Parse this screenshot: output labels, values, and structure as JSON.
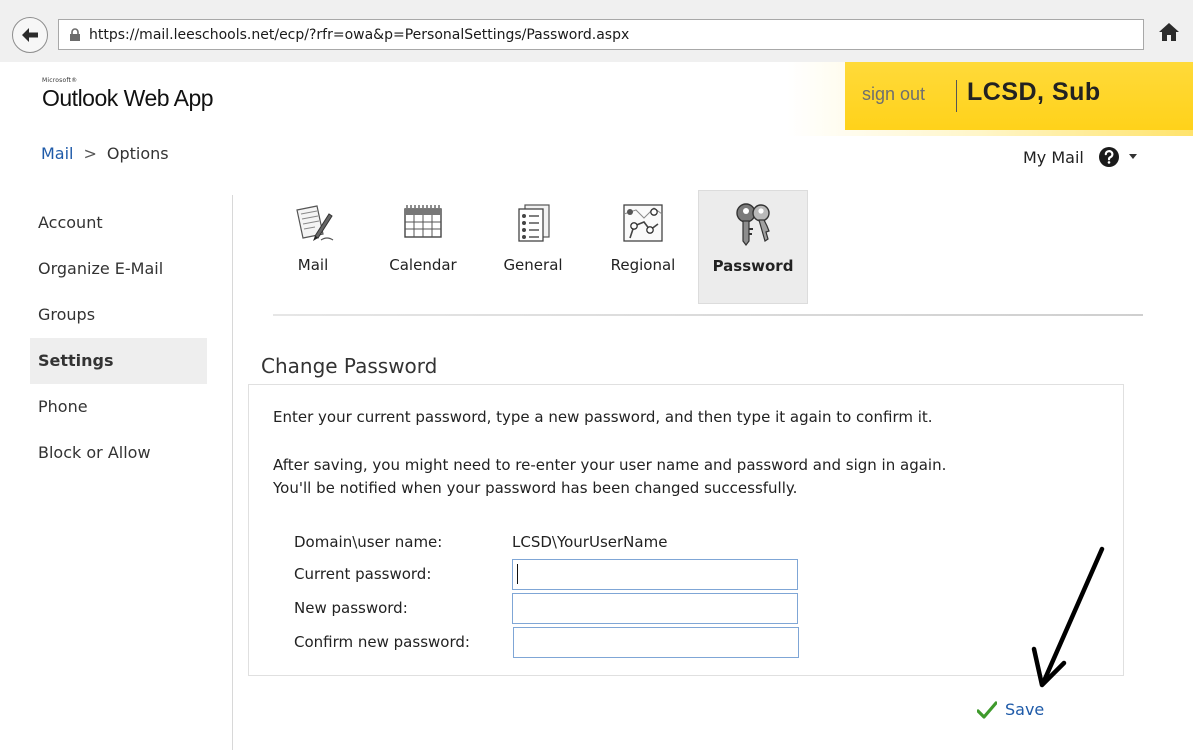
{
  "browser": {
    "url": "https://mail.leeschools.net/ecp/?rfr=owa&p=PersonalSettings/Password.aspx"
  },
  "header": {
    "logo_small": "Microsoft®",
    "app_name": "Outlook Web App",
    "sign_out": "sign out",
    "user_name": "LCSD, Sub",
    "accent_color": "#ffd324"
  },
  "breadcrumb": {
    "root": "Mail",
    "separator": ">",
    "current": "Options"
  },
  "topright": {
    "my_mail": "My Mail"
  },
  "sidebar": {
    "items": [
      {
        "label": "Account",
        "active": false
      },
      {
        "label": "Organize E-Mail",
        "active": false
      },
      {
        "label": "Groups",
        "active": false
      },
      {
        "label": "Settings",
        "active": true
      },
      {
        "label": "Phone",
        "active": false
      },
      {
        "label": "Block or Allow",
        "active": false
      }
    ]
  },
  "tabs": [
    {
      "label": "Mail",
      "icon": "mail-settings-icon"
    },
    {
      "label": "Calendar",
      "icon": "calendar-icon"
    },
    {
      "label": "General",
      "icon": "general-icon"
    },
    {
      "label": "Regional",
      "icon": "regional-icon"
    },
    {
      "label": "Password",
      "icon": "keys-icon",
      "active": true
    }
  ],
  "change_password": {
    "title": "Change Password",
    "intro": "Enter your current password, type a new password, and then type it again to confirm it.",
    "note_line1": "After saving, you might need to re-enter your user name and password and sign in again.",
    "note_line2": "You'll be notified when your password has been changed successfully.",
    "domain_label": "Domain\\user name:",
    "domain_value": "LCSD\\YourUserName",
    "current_label": "Current password:",
    "current_value": "",
    "new_label": "New password:",
    "new_value": "",
    "confirm_label": "Confirm new password:",
    "confirm_value": ""
  },
  "actions": {
    "save": "Save"
  }
}
